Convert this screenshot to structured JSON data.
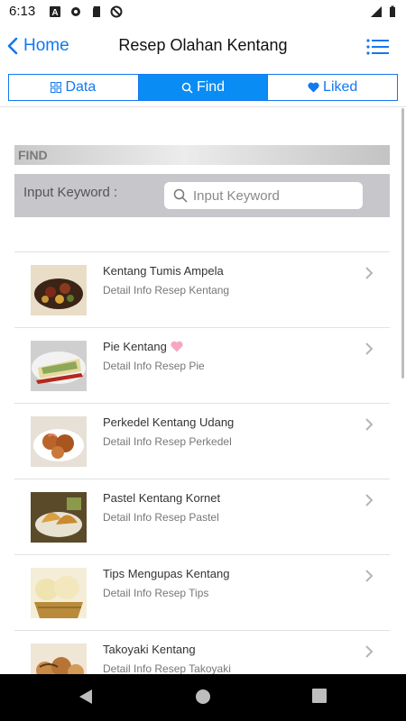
{
  "status_bar": {
    "time": "6:13"
  },
  "header": {
    "back_label": "Home",
    "title": "Resep Olahan Kentang"
  },
  "tabs": [
    {
      "label": "Data",
      "icon": "grid-icon"
    },
    {
      "label": "Find",
      "icon": "search-icon",
      "active": true
    },
    {
      "label": "Liked",
      "icon": "heart-icon"
    }
  ],
  "find": {
    "section_title": "FIND",
    "label": "Input Keyword :",
    "placeholder": "Input Keyword",
    "value": ""
  },
  "recipes": [
    {
      "title": "Kentang Tumis Ampela",
      "subtitle": "Detail Info Resep Kentang",
      "liked": false
    },
    {
      "title": "Pie Kentang",
      "subtitle": "Detail Info Resep Pie",
      "liked": true
    },
    {
      "title": "Perkedel Kentang Udang",
      "subtitle": "Detail Info Resep Perkedel",
      "liked": false
    },
    {
      "title": "Pastel Kentang Kornet",
      "subtitle": "Detail Info Resep Pastel",
      "liked": false
    },
    {
      "title": "Tips Mengupas Kentang",
      "subtitle": "Detail Info Resep Tips",
      "liked": false
    },
    {
      "title": "Takoyaki Kentang",
      "subtitle": "Detail Info Resep Takoyaki",
      "liked": false
    }
  ],
  "colors": {
    "accent": "#1478ee",
    "active_tab": "#0a8cf5",
    "liked_heart": "#f7a8c0"
  }
}
